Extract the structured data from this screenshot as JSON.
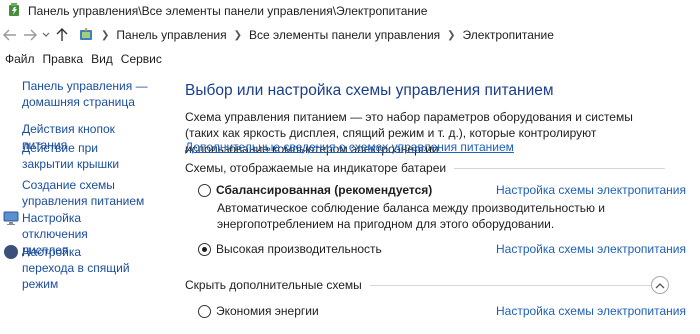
{
  "window": {
    "title": "Панель управления\\Все элементы панели управления\\Электропитание"
  },
  "nav": {
    "back_icon": "back-arrow-icon",
    "forward_icon": "forward-arrow-icon",
    "up_icon": "up-arrow-icon"
  },
  "breadcrumb": {
    "items": [
      "Панель управления",
      "Все элементы панели управления",
      "Электропитание"
    ]
  },
  "menu": {
    "items": [
      "Файл",
      "Правка",
      "Вид",
      "Сервис"
    ]
  },
  "sidebar": {
    "home_link": "Панель управления — домашняя страница",
    "links": [
      "Действия кнопок питания",
      "Действие при закрытии крышки",
      "Создание схемы управления питанием",
      "Настройка отключения дисплея",
      "Настройка перехода в спящий режим"
    ]
  },
  "main": {
    "title": "Выбор или настройка схемы управления питанием",
    "description": "Схема управления питанием — это набор параметров оборудования и системы (таких как яркость дисплея, спящий режим и т. д.), которые контролируют использование компьютером электроэнергии.",
    "more_link": "Дополнительные сведения о схемах управления питанием",
    "battery_section": "Схемы, отображаемые на индикаторе батареи",
    "hidden_section": "Скрыть дополнительные схемы",
    "plans": [
      {
        "name": "Сбалансированная (рекомендуется)",
        "selected": false,
        "settings_link": "Настройка схемы электропитания",
        "description": "Автоматическое соблюдение баланса между производительностью и энергопотреблением на пригодном для этого оборудовании."
      },
      {
        "name": "Высокая производительность",
        "selected": true,
        "settings_link": "Настройка схемы электропитания"
      },
      {
        "name": "Экономия энергии",
        "selected": false,
        "settings_link": "Настройка схемы электропитания"
      }
    ]
  },
  "colors": {
    "link": "#1f5fb8",
    "title": "#1a3e8c",
    "sidebar_link": "#1a4d9c"
  }
}
